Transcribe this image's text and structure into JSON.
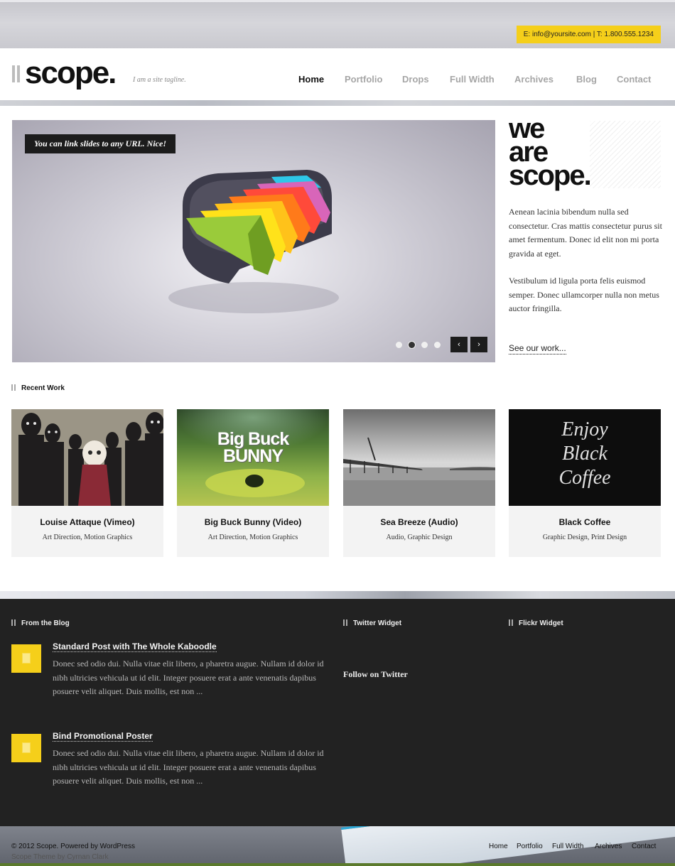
{
  "topbar": {
    "contact": "E: info@yoursite.com  |  T: 1.800.555.1234",
    "accent": "#f5cf1a"
  },
  "header": {
    "logo": "scope.",
    "tagline": "I am a site tagline.",
    "nav": [
      "Home",
      "Portfolio",
      "Drops",
      "Full Width",
      "Archives",
      "Blog",
      "Contact"
    ],
    "active_nav": "Home"
  },
  "slider": {
    "caption": "You can link slides to any URL. Nice!",
    "slide_count": 4,
    "active_slide": 2,
    "prev_symbol": "‹",
    "next_symbol": "›"
  },
  "intro": {
    "heading": [
      "we",
      "are",
      "scope."
    ],
    "paragraph1": "Aenean lacinia bibendum nulla sed consectetur. Cras mattis consectetur purus sit amet fermentum. Donec id elit non mi porta gravida at eget.",
    "paragraph2": "Vestibulum id ligula porta felis euismod semper. Donec ullamcorper nulla non metus auctor fringilla.",
    "link": "See our work..."
  },
  "recent_work": {
    "heading": "Recent Work",
    "items": [
      {
        "title": "Louise Attaque (Vimeo)",
        "categories": "Art Direction, Motion Graphics"
      },
      {
        "title": "Big Buck Bunny (Video)",
        "categories": "Art Direction, Motion Graphics",
        "thumb_text": [
          "Big Buck",
          "BUNNY"
        ]
      },
      {
        "title": "Sea Breeze (Audio)",
        "categories": "Audio, Graphic Design"
      },
      {
        "title": "Black Coffee",
        "categories": "Graphic Design, Print Design",
        "thumb_text": [
          "Enjoy",
          "Black",
          "Coffee"
        ]
      }
    ]
  },
  "footer": {
    "blog_heading": "From the Blog",
    "twitter_heading": "Twitter Widget",
    "flickr_heading": "Flickr Widget",
    "follow": "Follow on Twitter",
    "posts": [
      {
        "title": "Standard Post with The Whole Kaboodle",
        "excerpt": "Donec sed odio dui. Nulla vitae elit libero, a pharetra augue. Nullam id dolor id nibh ultricies vehicula ut id elit. Integer posuere erat a ante venenatis dapibus posuere velit aliquet. Duis mollis, est non ..."
      },
      {
        "title": "Bind Promotional Poster",
        "excerpt": "Donec sed odio dui. Nulla vitae elit libero, a pharetra augue. Nullam id dolor id nibh ultricies vehicula ut id elit. Integer posuere erat a ante venenatis dapibus posuere velit aliquet. Duis mollis, est non ..."
      }
    ]
  },
  "bottom": {
    "copyright": "© 2012 Scope. Powered by WordPress",
    "credit": "Scope Theme by Cyrnan Clark",
    "nav": [
      "Home",
      "Portfolio",
      "Full Width",
      "Archives",
      "Contact"
    ]
  }
}
